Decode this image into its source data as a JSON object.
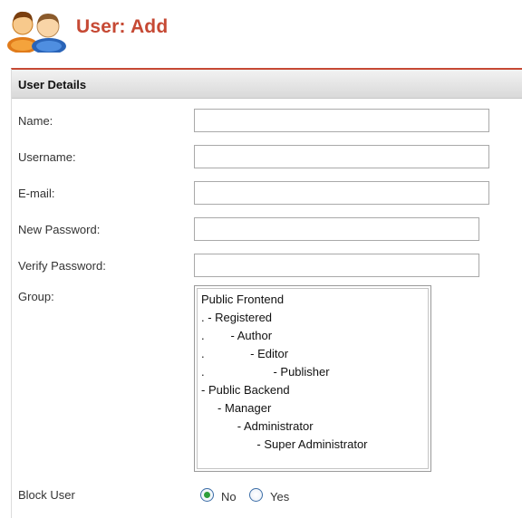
{
  "page": {
    "title": "User: Add",
    "icon": "users-icon"
  },
  "panel": {
    "title": "User Details"
  },
  "fields": {
    "name": {
      "label": "Name:",
      "value": ""
    },
    "username": {
      "label": "Username:",
      "value": ""
    },
    "email": {
      "label": "E-mail:",
      "value": ""
    },
    "new_password": {
      "label": "New Password:",
      "value": ""
    },
    "verify_password": {
      "label": "Verify Password:",
      "value": ""
    }
  },
  "group": {
    "label": "Group:",
    "options": [
      "Public Frontend",
      ". - Registered",
      ".        - Author",
      ".              - Editor",
      ".                     - Publisher",
      "- Public Backend",
      "     - Manager",
      "           - Administrator",
      "                 - Super Administrator"
    ]
  },
  "block_user": {
    "label": "Block User",
    "options": [
      "No",
      "Yes"
    ],
    "selected": "No"
  },
  "colors": {
    "accent": "#c64934",
    "radio_selected": "#2e9e3a"
  }
}
